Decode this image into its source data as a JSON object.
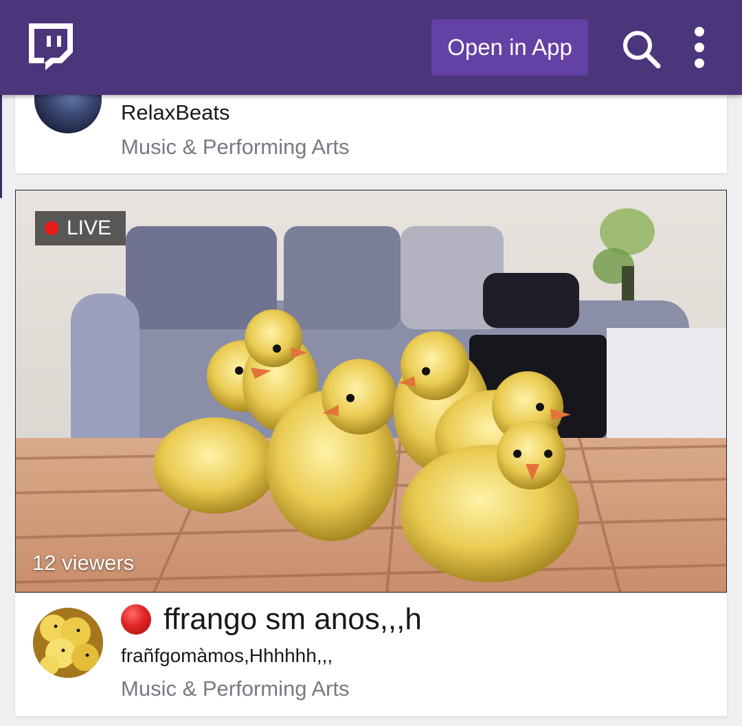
{
  "header": {
    "open_in_app_label": "Open in App",
    "brand_color": "#4b367c",
    "button_color": "#6441a4",
    "icons": [
      "twitch-logo-icon",
      "search-icon",
      "more-vertical-icon"
    ]
  },
  "previous_stream": {
    "channel": "RelaxBeats",
    "category": "Music & Performing Arts"
  },
  "stream": {
    "live_label": "LIVE",
    "viewers": "12 viewers",
    "title": "ffrango sm anos,,,h",
    "channel": "frañfgomàmos,Hhhhhh,,,",
    "category": "Music & Performing Arts",
    "live_color": "#e91916"
  }
}
